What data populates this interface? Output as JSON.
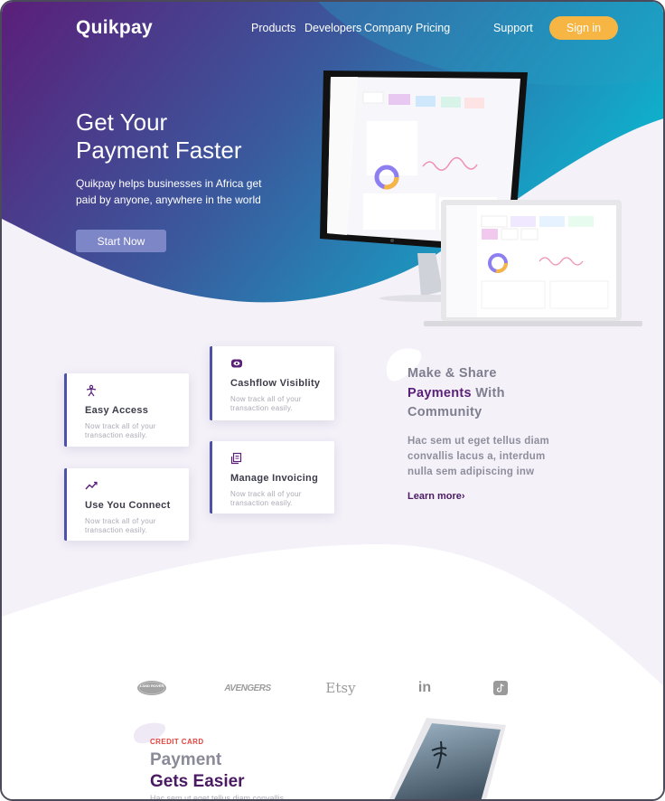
{
  "brand": {
    "name": "Quikpay"
  },
  "nav": {
    "links": [
      "Products",
      "Developers",
      "Company",
      "Pricing"
    ],
    "support": "Support",
    "signin": "Sign in"
  },
  "hero": {
    "title_line1": "Get Your",
    "title_line2": "Payment Faster",
    "description": "Quikpay helps businesses in Africa get paid by anyone, anywhere in the world",
    "cta": "Start Now"
  },
  "features": [
    {
      "title": "Easy Access",
      "desc": "Now track all of your transaction easily.",
      "icon": "person-icon"
    },
    {
      "title": "Cashflow Visiblity",
      "desc": "Now track all of your transaction easily.",
      "icon": "eye-icon"
    },
    {
      "title": "Use You Connect",
      "desc": "Now track all of your transaction easily.",
      "icon": "trend-icon"
    },
    {
      "title": "Manage Invoicing",
      "desc": "Now track all of your transaction easily.",
      "icon": "invoice-icon"
    }
  ],
  "community": {
    "title_pre": "Make & Share",
    "title_accent": "Payments",
    "title_mid": "With",
    "title_post": "Community",
    "description": "Hac sem ut eget tellus diam convallis lacus a, interdum nulla sem adipiscing inw",
    "link": "Learn more"
  },
  "partners": [
    {
      "name": "LAND ROVER",
      "icon": "land-rover-logo"
    },
    {
      "name": "AVENGERS",
      "icon": "avengers-logo"
    },
    {
      "name": "Etsy",
      "icon": "etsy-logo"
    },
    {
      "name": "in",
      "icon": "linkedin-logo"
    },
    {
      "name": "",
      "icon": "tiktok-logo"
    }
  ],
  "credit": {
    "label": "CREDIT CARD",
    "title_line1": "Payment",
    "title_line2": "Gets Easier",
    "description": "Hac sem ut eget tellus diam convallis"
  },
  "colors": {
    "hero_start": "#5b1e79",
    "hero_end": "#16a7c8",
    "accent_orange": "#f7b544",
    "purple_dark": "#4a1a63",
    "soft_lavender": "#f4f1f9",
    "button_blue": "#7d86c7",
    "credit_red": "#e5443f"
  }
}
